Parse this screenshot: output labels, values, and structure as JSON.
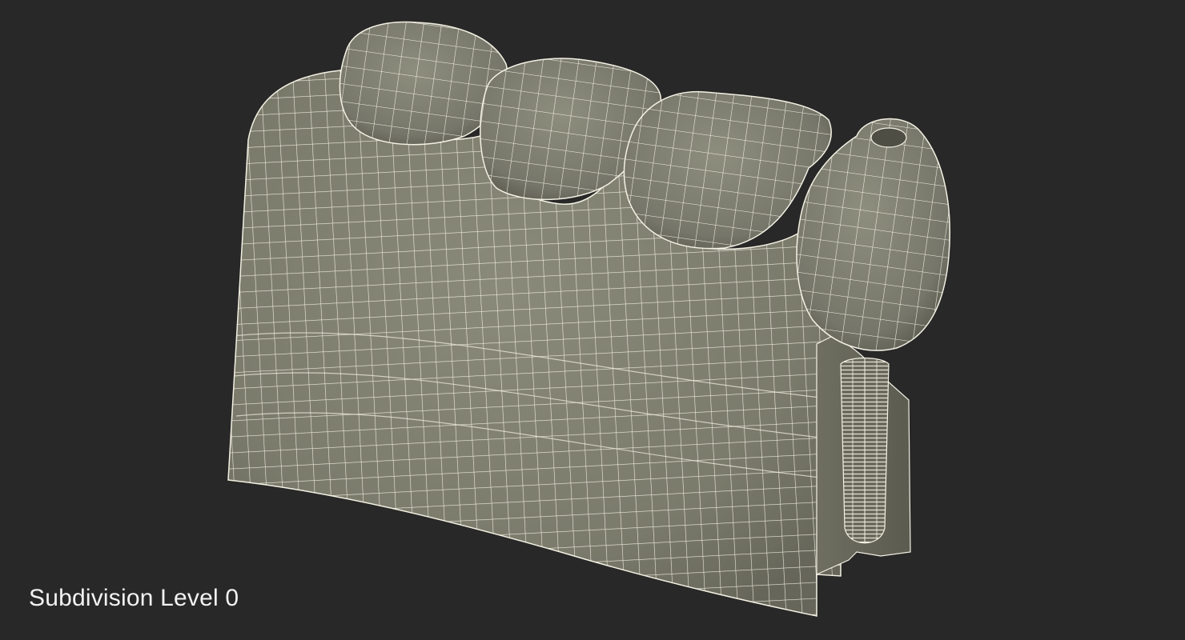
{
  "viewport": {
    "background_color": "#282828",
    "caption": "Subdivision Level 0"
  },
  "model": {
    "description_icon": "dental-implant-model-icon",
    "surface_color": "#7d7d6e",
    "wire_color": "#f3f1e3",
    "shadow_color": "#5f5f54"
  }
}
